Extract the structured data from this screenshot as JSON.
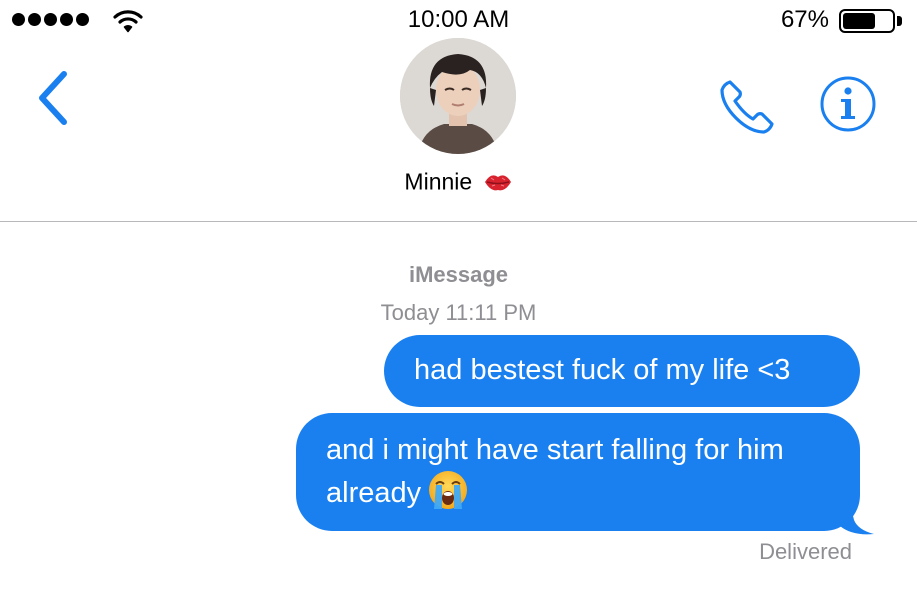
{
  "status_bar": {
    "time": "10:00 AM",
    "battery_percent": "67%",
    "battery_level": 0.67,
    "signal_dots": 5
  },
  "header": {
    "contact_name": "Minnie",
    "name_emoji": "lips-icon"
  },
  "conversation": {
    "service": "iMessage",
    "timestamp": "Today 11:11 PM",
    "messages": [
      {
        "text": "had bestest fuck of my life <3",
        "emoji": ""
      },
      {
        "text": "and i might have start falling for him already",
        "emoji": "loudly-crying-face-icon"
      }
    ],
    "status": "Delivered"
  },
  "colors": {
    "accent": "#1a80f0",
    "bubble": "#1a80f0",
    "secondary_text": "#8e8e93",
    "divider": "#b8b8bc"
  }
}
